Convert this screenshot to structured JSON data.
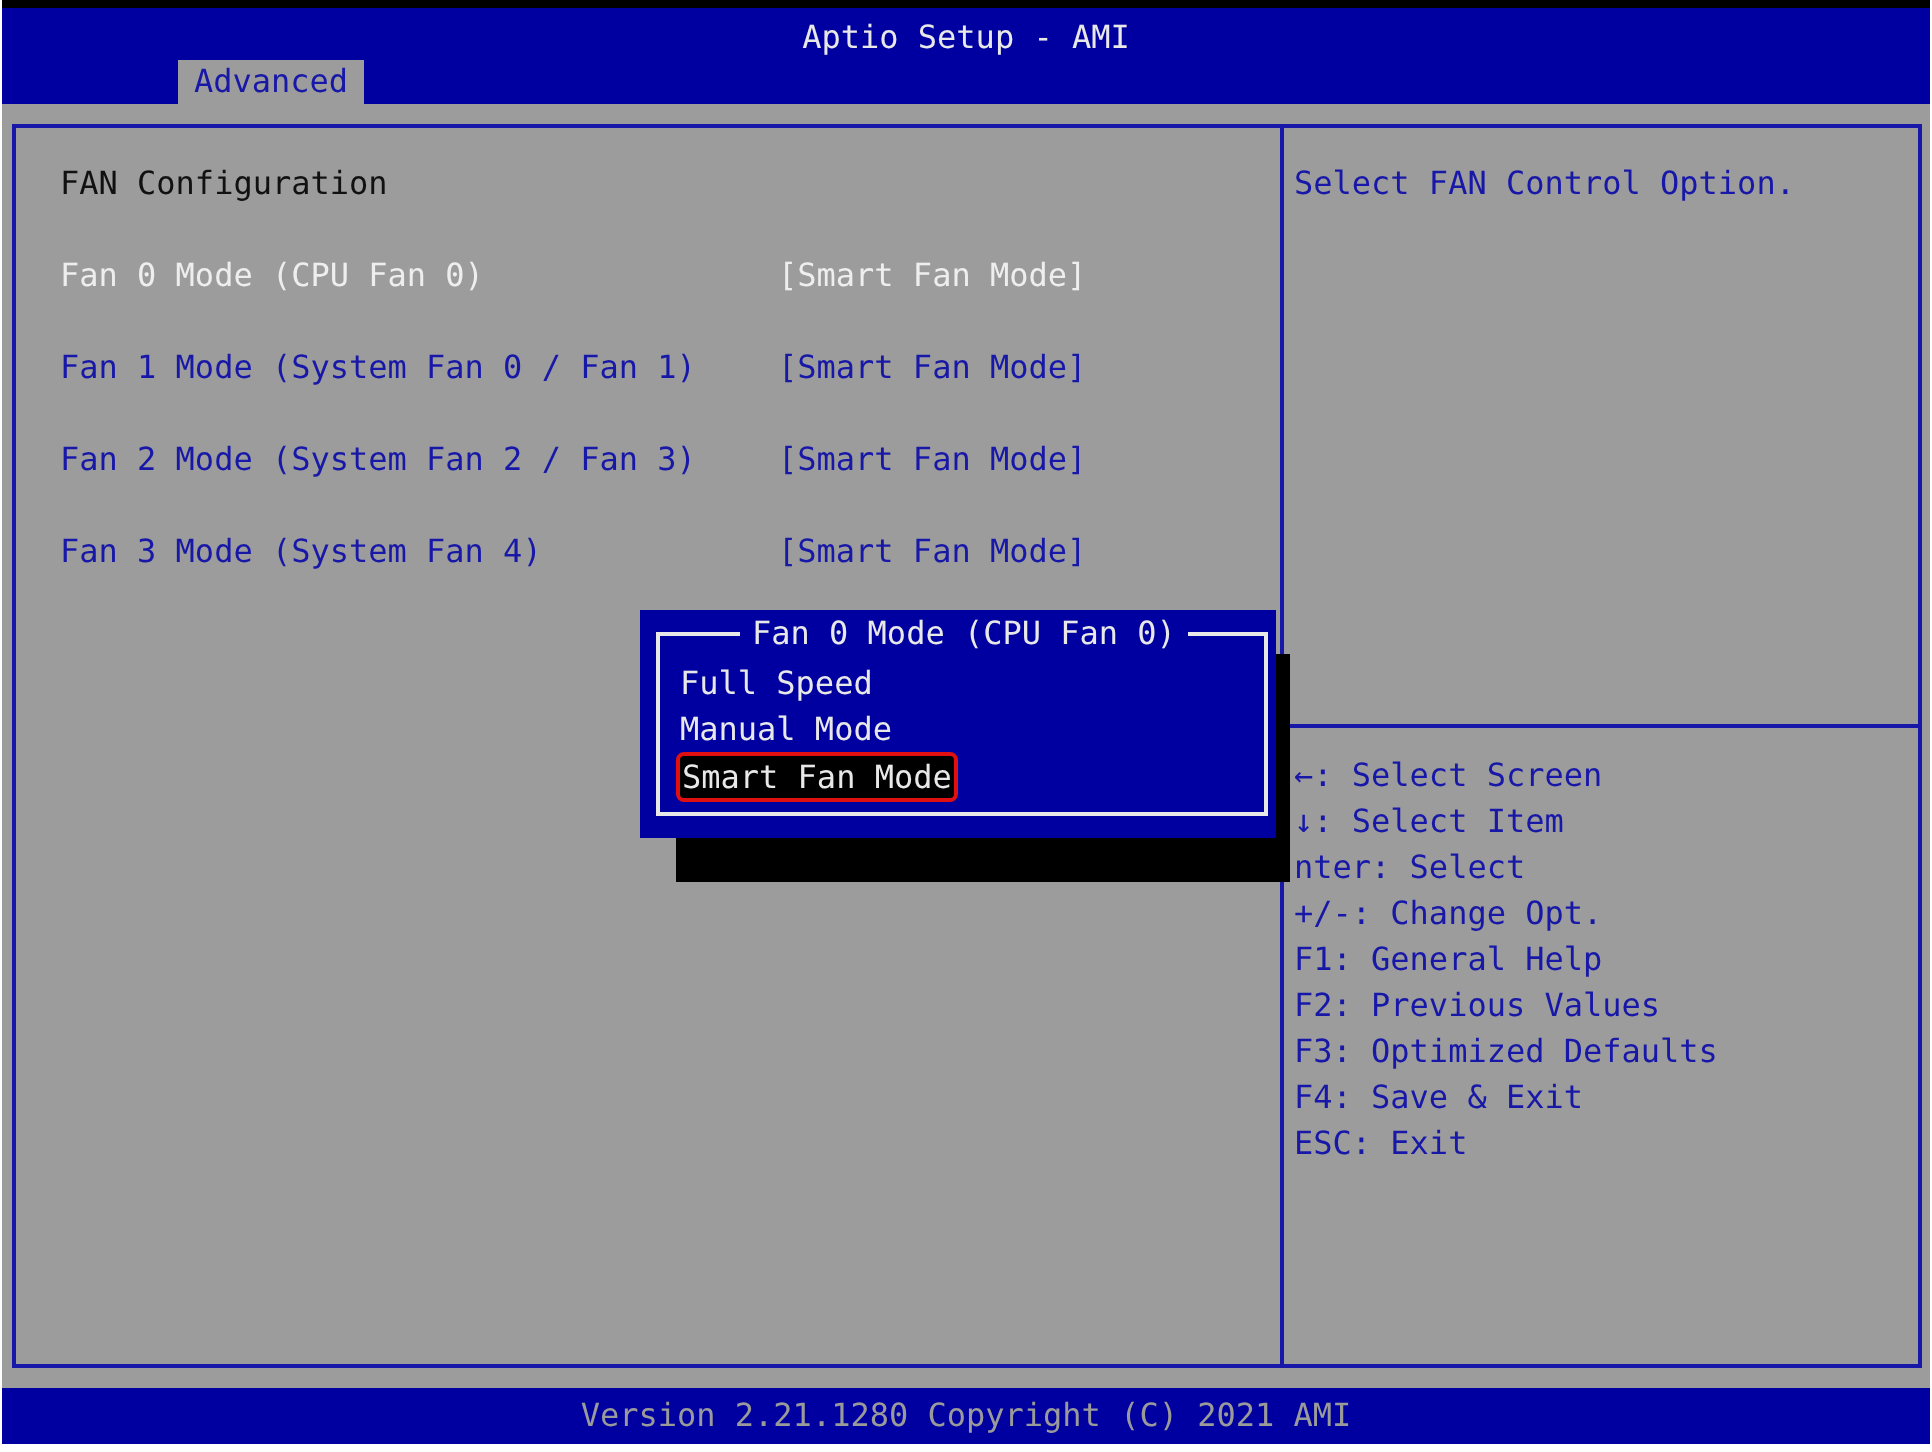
{
  "window": {
    "title": "Aptio Setup - AMI"
  },
  "tabs": [
    {
      "label": "Advanced",
      "selected": true
    }
  ],
  "page": {
    "heading": "FAN Configuration",
    "items": [
      {
        "label": "Fan 0 Mode (CPU Fan 0)",
        "value": "[Smart Fan Mode]",
        "selected": true
      },
      {
        "label": "Fan 1 Mode (System Fan 0 / Fan 1)",
        "value": "[Smart Fan Mode]",
        "selected": false
      },
      {
        "label": "Fan 2 Mode (System Fan 2 / Fan 3)",
        "value": "[Smart Fan Mode]",
        "selected": false
      },
      {
        "label": "Fan 3 Mode (System Fan 4)",
        "value": "[Smart Fan Mode]",
        "selected": false
      }
    ]
  },
  "help": {
    "description": "Select FAN Control Option.",
    "keys": [
      "←: Select Screen",
      "↓: Select Item",
      "nter: Select",
      "+/-: Change Opt.",
      "F1: General Help",
      "F2: Previous Values",
      "F3: Optimized Defaults",
      "F4: Save & Exit",
      "ESC: Exit"
    ]
  },
  "popup": {
    "title": "Fan 0 Mode (CPU Fan 0)",
    "options": [
      {
        "label": "Full Speed",
        "selected": false
      },
      {
        "label": "Manual Mode",
        "selected": false
      },
      {
        "label": "Smart Fan Mode",
        "selected": true
      }
    ]
  },
  "status_bar": "Version 2.21.1280 Copyright (C) 2021 AMI"
}
